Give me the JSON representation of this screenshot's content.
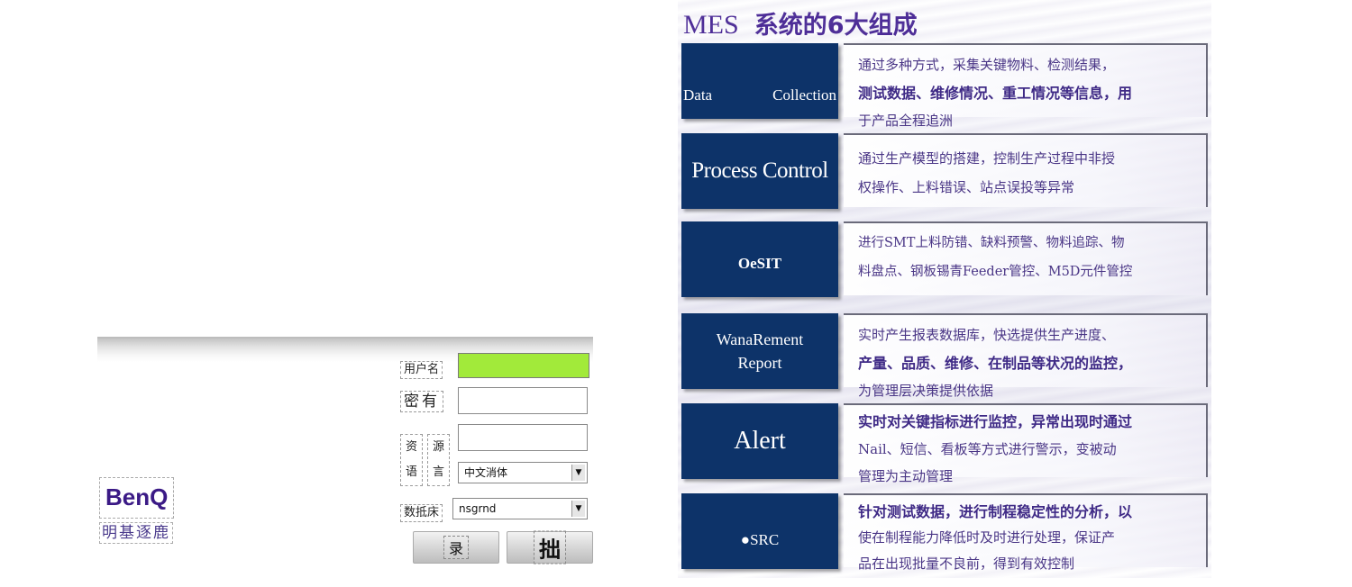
{
  "login": {
    "username_label": "用户名",
    "password_label": "密有",
    "resource_label_1": "资",
    "resource_label_2": "源",
    "language_label_1": "语",
    "language_label_2": "言",
    "language_value": "中文消体",
    "database_label": "数抵床",
    "database_value": "nsgrnd",
    "login_button": "录",
    "exit_button": "拙",
    "brand_logo": "BenQ",
    "brand_cn": "明基逐鹿",
    "colors": {
      "username_field": "#a2ea3a"
    }
  },
  "slide": {
    "title_latin": "MES",
    "title_cn": "系统的6大组成",
    "colors": {
      "box": "#0d3369",
      "title": "#4b2a96",
      "text": "#4a3686"
    },
    "items": [
      {
        "label_a": "Data",
        "label_b": "Collection",
        "desc_1": "通过多种方式，采集关键物料、检测结果，",
        "desc_2": "测试数据、维修情况、重工情况等信息，用",
        "desc_3": "于产品全程追洲"
      },
      {
        "label": "Process Control",
        "desc_1": "通过生产模型的搭建，控制生产过程中非授",
        "desc_2": "权操作、上料错误、站点误投等异常"
      },
      {
        "label": "OeSIT",
        "desc_1": "进行SMT上料防错、缺料预警、物料追踪、物",
        "desc_2": "料盘点、钢板锡青Feeder管控、M5D元件管控"
      },
      {
        "label_a": "WanaRement",
        "label_b": "Report",
        "desc_1": "实时产生报表数据库，快选提供生产进度、",
        "desc_2": "产量、品质、维修、在制品等状况的监控，",
        "desc_3": "为管理层决策提供依据"
      },
      {
        "label": "Alert",
        "desc_1": "实时对关键指标进行监控，异常出现时通过",
        "desc_2": "Nail、短信、看板等方式进行警示，变被动",
        "desc_3": "管理为主动管理"
      },
      {
        "label": "●SRC",
        "desc_1": "针对测试数据，进行制程稳定性的分析，以",
        "desc_2": "使在制程能力降低时及时进行处理，保证产",
        "desc_3": "品在出现批量不良前，得到有效控制"
      }
    ]
  }
}
